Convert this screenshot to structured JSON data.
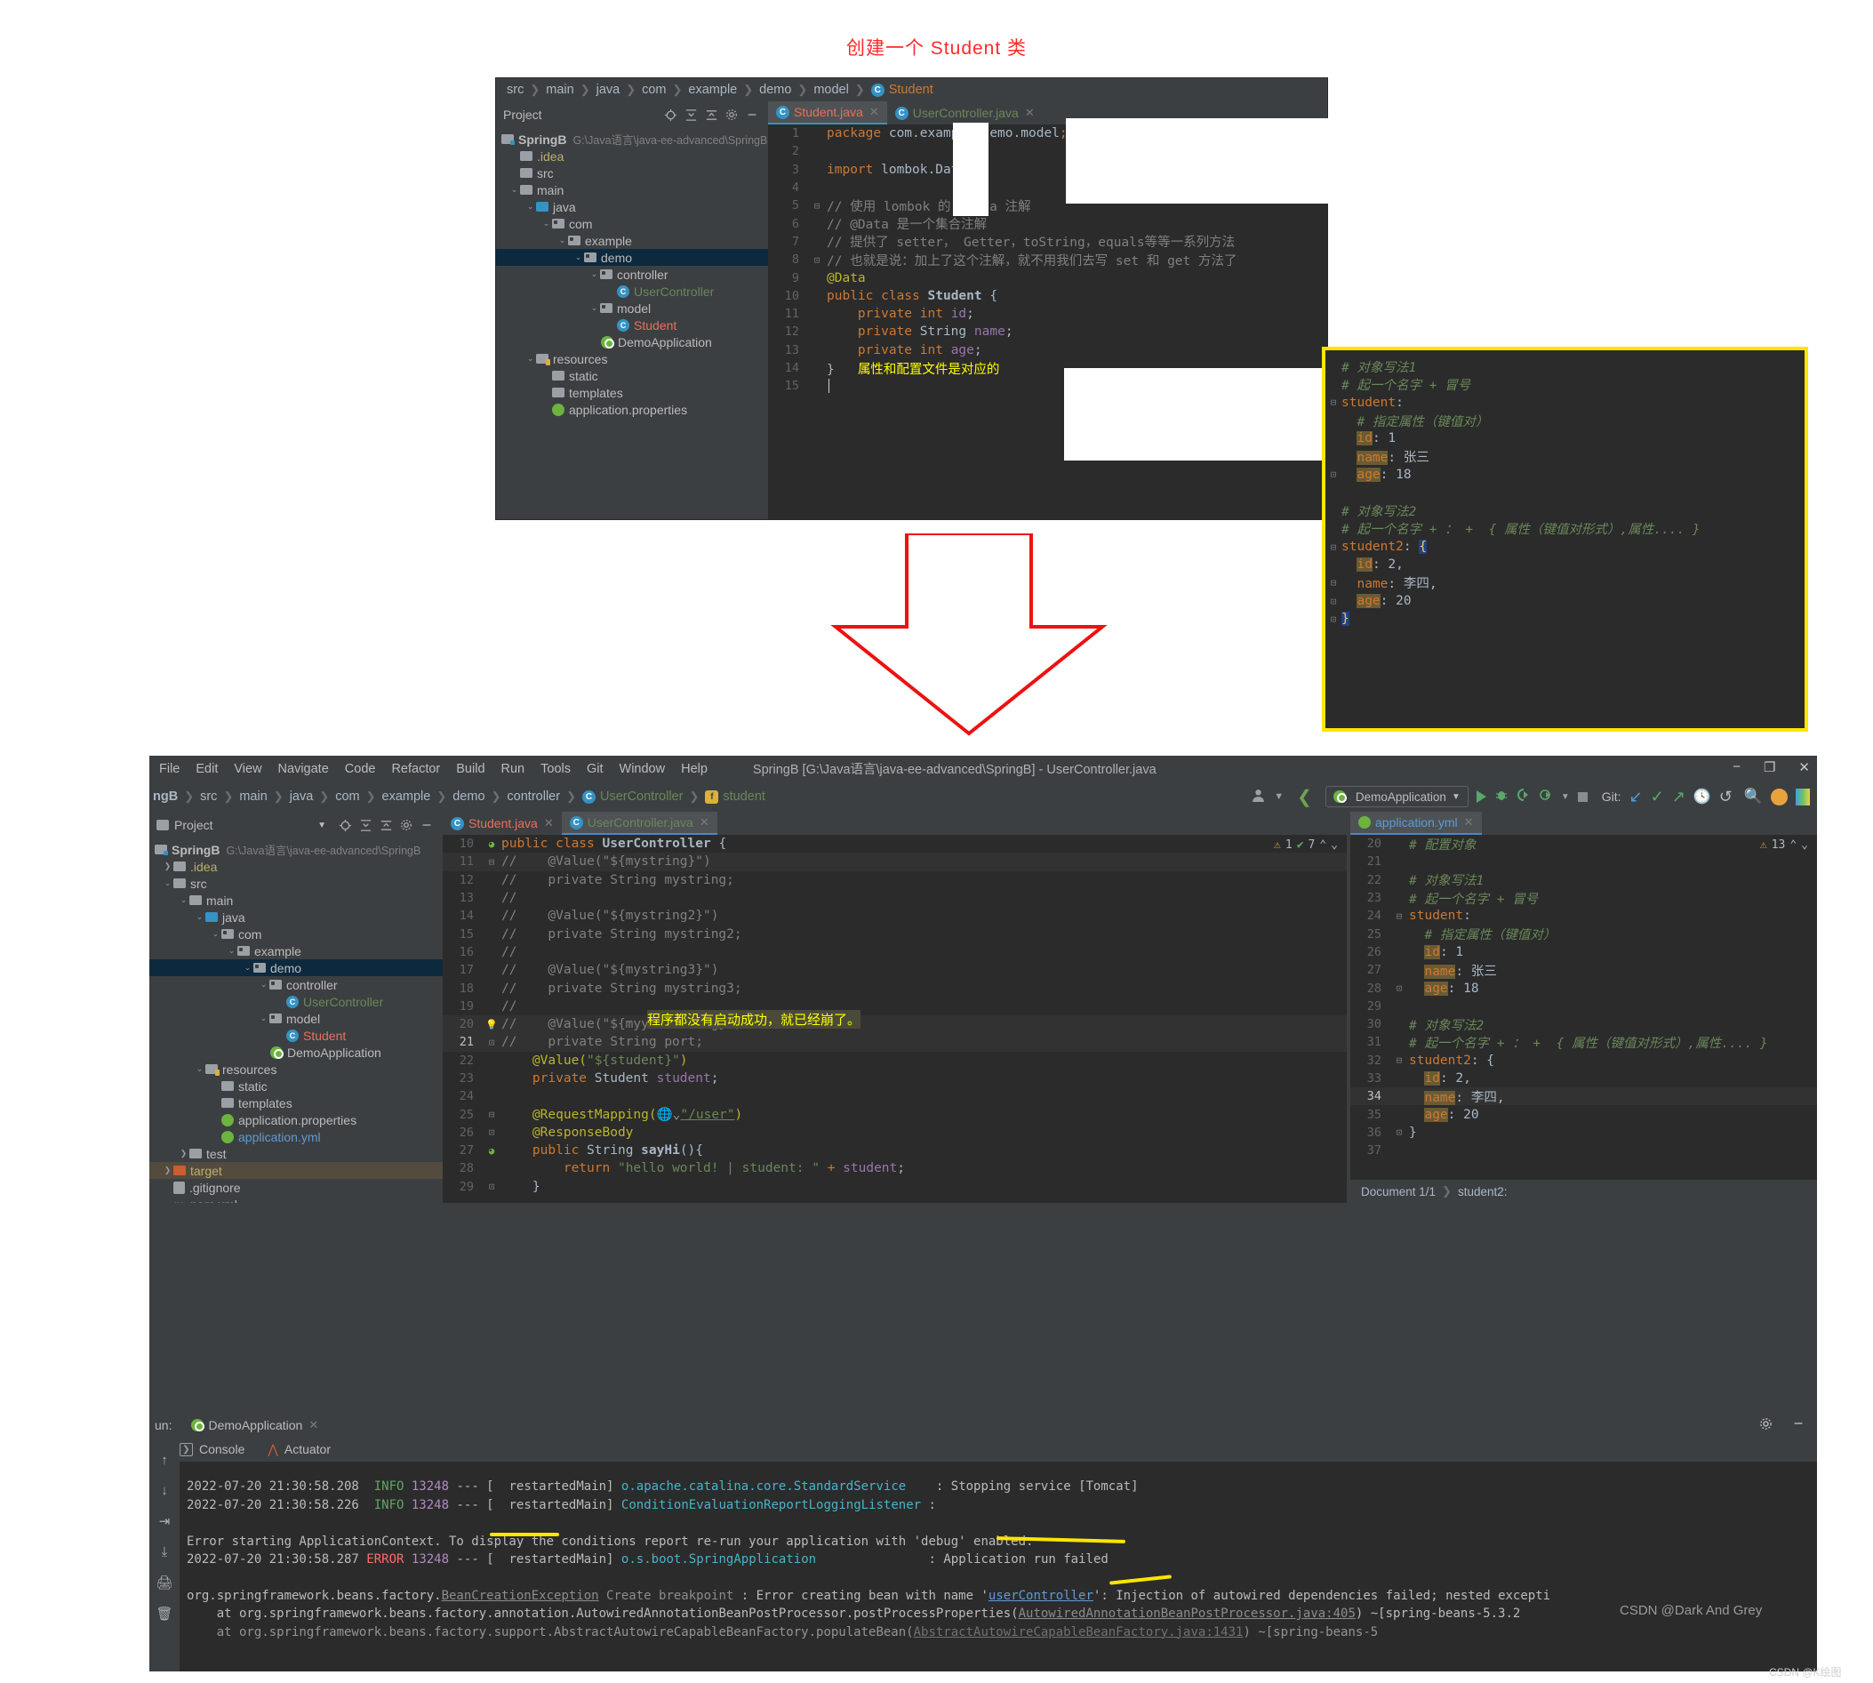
{
  "title": "创建一个 Student 类",
  "top_window": {
    "breadcrumb": [
      "src",
      "main",
      "java",
      "com",
      "example",
      "demo",
      "model"
    ],
    "breadcrumb_current": "Student",
    "project_panel": {
      "label": "Project",
      "root_name": "SpringB",
      "root_path": "G:\\Java语言\\java-ee-advanced\\SpringB",
      "items": [
        {
          "label": ".idea",
          "indent": 1
        },
        {
          "label": "src",
          "indent": 1
        },
        {
          "label": "main",
          "indent": 2
        },
        {
          "label": "java",
          "indent": 3
        },
        {
          "label": "com",
          "indent": 4
        },
        {
          "label": "example",
          "indent": 5
        },
        {
          "label": "demo",
          "indent": 6
        },
        {
          "label": "controller",
          "indent": 7
        },
        {
          "label": "UserController",
          "indent": 8
        },
        {
          "label": "model",
          "indent": 7
        },
        {
          "label": "Student",
          "indent": 8
        },
        {
          "label": "DemoApplication",
          "indent": 7
        },
        {
          "label": "resources",
          "indent": 3
        },
        {
          "label": "static",
          "indent": 4
        },
        {
          "label": "templates",
          "indent": 4
        },
        {
          "label": "application.properties",
          "indent": 4
        }
      ]
    },
    "tabs": [
      {
        "label": "Student.java",
        "active": true
      },
      {
        "label": "UserController.java",
        "active": false
      }
    ],
    "code_lines": [
      {
        "n": "1",
        "text": "package com.example.demo.model;"
      },
      {
        "n": "2",
        "text": ""
      },
      {
        "n": "3",
        "text": "import lombok.Data;"
      },
      {
        "n": "4",
        "text": ""
      },
      {
        "n": "5",
        "text": "// 使用 lombok 的 @Data 注解"
      },
      {
        "n": "6",
        "text": "// @Data 是一个集合注解"
      },
      {
        "n": "7",
        "text": "// 提供了 setter， Getter，toString，equals等等一系列方法"
      },
      {
        "n": "8",
        "text": "// 也就是说：加上了这个注解，就不用我们去写 set 和 get 方法了"
      },
      {
        "n": "9",
        "text": "@Data"
      },
      {
        "n": "10",
        "text": "public class Student {"
      },
      {
        "n": "11",
        "text": "    private int id;"
      },
      {
        "n": "12",
        "text": "    private String name;"
      },
      {
        "n": "13",
        "text": "    private int age;"
      },
      {
        "n": "14",
        "text": "}"
      },
      {
        "n": "15",
        "text": ""
      }
    ],
    "inline_note": "属性和配置文件是对应的"
  },
  "yml_card": {
    "lines": [
      "# 对象写法1",
      "# 起一个名字 + 冒号",
      "student:",
      "  # 指定属性（键值对）",
      "  id: 1",
      "  name: 张三",
      "  age: 18",
      "",
      "# 对象写法2",
      "# 起一个名字 + ： +  { 属性（键值对形式）,属性.... }",
      "student2: {",
      "  id: 2,",
      "  name: 李四,",
      "  age: 20",
      "}"
    ]
  },
  "bottom_window": {
    "menu": [
      "File",
      "Edit",
      "View",
      "Navigate",
      "Code",
      "Refactor",
      "Build",
      "Run",
      "Tools",
      "Git",
      "Window",
      "Help"
    ],
    "window_title": "SpringB [G:\\Java语言\\java-ee-advanced\\SpringB] - UserController.java",
    "window_buttons": [
      "−",
      "❐",
      "✕"
    ],
    "breadcrumb": [
      "ngB",
      "src",
      "main",
      "java",
      "com",
      "example",
      "demo",
      "controller"
    ],
    "breadcrumb_class": "UserController",
    "breadcrumb_field": "student",
    "toolbar": {
      "run_config": "DemoApplication",
      "git_label": "Git:"
    },
    "project_panel": {
      "label": "Project",
      "root_name": "SpringB",
      "root_path": "G:\\Java语言\\java-ee-advanced\\SpringB",
      "items": [
        {
          "label": ".idea",
          "indent": 1
        },
        {
          "label": "src",
          "indent": 1
        },
        {
          "label": "main",
          "indent": 2
        },
        {
          "label": "java",
          "indent": 3
        },
        {
          "label": "com",
          "indent": 4
        },
        {
          "label": "example",
          "indent": 5
        },
        {
          "label": "demo",
          "indent": 6
        },
        {
          "label": "controller",
          "indent": 7
        },
        {
          "label": "UserController",
          "indent": 8
        },
        {
          "label": "model",
          "indent": 7
        },
        {
          "label": "Student",
          "indent": 8
        },
        {
          "label": "DemoApplication",
          "indent": 7
        },
        {
          "label": "resources",
          "indent": 3
        },
        {
          "label": "static",
          "indent": 4
        },
        {
          "label": "templates",
          "indent": 4
        },
        {
          "label": "application.properties",
          "indent": 4
        },
        {
          "label": "application.yml",
          "indent": 4
        },
        {
          "label": "test",
          "indent": 2
        },
        {
          "label": "target",
          "indent": 1
        },
        {
          "label": ".gitignore",
          "indent": 1
        },
        {
          "label": "pom.xml",
          "indent": 1
        }
      ]
    },
    "tabs": [
      {
        "label": "Student.java",
        "active": false
      },
      {
        "label": "UserController.java",
        "active": true
      }
    ],
    "code_lines": [
      {
        "n": "10",
        "text": "public class UserController {"
      },
      {
        "n": "11",
        "text": "//    @Value(\"${mystring}\")"
      },
      {
        "n": "12",
        "text": "//    private String mystring;"
      },
      {
        "n": "13",
        "text": "//"
      },
      {
        "n": "14",
        "text": "//    @Value(\"${mystring2}\")"
      },
      {
        "n": "15",
        "text": "//    private String mystring2;"
      },
      {
        "n": "16",
        "text": "//"
      },
      {
        "n": "17",
        "text": "//    @Value(\"${mystring3}\")"
      },
      {
        "n": "18",
        "text": "//    private String mystring3;"
      },
      {
        "n": "19",
        "text": "//"
      },
      {
        "n": "20",
        "text": "//    @Value(\"${myyml.string}\")"
      },
      {
        "n": "21",
        "text": "//    private String port;"
      },
      {
        "n": "22",
        "text": "    @Value(\"${student}\")"
      },
      {
        "n": "23",
        "text": "    private Student student;"
      },
      {
        "n": "24",
        "text": ""
      },
      {
        "n": "25",
        "text": "    @RequestMapping(\"/user\")"
      },
      {
        "n": "26",
        "text": "    @ResponseBody"
      },
      {
        "n": "27",
        "text": "    public String sayHi(){"
      },
      {
        "n": "28",
        "text": "        return \"hello world! | student: \" + student;"
      },
      {
        "n": "29",
        "text": "    }"
      }
    ],
    "inspection": {
      "warnings": "1",
      "checks": "7"
    },
    "yml_tab": {
      "label": "application.yml",
      "warnings": "13"
    },
    "yml_lines": [
      {
        "n": "20",
        "text": "# 配置对象"
      },
      {
        "n": "21",
        "text": ""
      },
      {
        "n": "22",
        "text": "# 对象写法1"
      },
      {
        "n": "23",
        "text": "# 起一个名字 + 冒号"
      },
      {
        "n": "24",
        "text": "student:"
      },
      {
        "n": "25",
        "text": "  # 指定属性（键值对）"
      },
      {
        "n": "26",
        "text": "  id: 1"
      },
      {
        "n": "27",
        "text": "  name: 张三"
      },
      {
        "n": "28",
        "text": "  age: 18"
      },
      {
        "n": "29",
        "text": ""
      },
      {
        "n": "30",
        "text": "# 对象写法2"
      },
      {
        "n": "31",
        "text": "# 起一个名字 + ： +  { 属性（键值对形式）,属性.... }"
      },
      {
        "n": "32",
        "text": "student2: {"
      },
      {
        "n": "33",
        "text": "  id: 2,"
      },
      {
        "n": "34",
        "text": "  name: 李四,"
      },
      {
        "n": "35",
        "text": "  age: 20"
      },
      {
        "n": "36",
        "text": "}"
      },
      {
        "n": "37",
        "text": ""
      }
    ],
    "yml_status": {
      "document": "Document 1/1",
      "path": "student2:"
    },
    "run_panel": {
      "run_label": "un:",
      "config_tab": "DemoApplication",
      "tabs": [
        "Console",
        "Actuator"
      ],
      "annotation": "程序都没有启动成功，就已经崩了。",
      "console_lines": [
        "2022-07-20 21:30:58.208  INFO 13248 --- [  restartedMain] o.apache.catalina.core.StandardService    : Stopping service [Tomcat]",
        "2022-07-20 21:30:58.226  INFO 13248 --- [  restartedMain] ConditionEvaluationReportLoggingListener :",
        "",
        "Error starting ApplicationContext. To display the conditions report re-run your application with 'debug' enabled.",
        "2022-07-20 21:30:58.287 ERROR 13248 --- [  restartedMain] o.s.boot.SpringApplication               : Application run failed",
        "",
        "org.springframework.beans.factory.BeanCreationException Create breakpoint : Error creating bean with name 'userController': Injection of autowired dependencies failed; nested excepti",
        "    at org.springframework.beans.factory.annotation.AutowiredAnnotationBeanPostProcessor.postProcessProperties(AutowiredAnnotationBeanPostProcessor.java:405) ~[spring-beans-5.3.2",
        "    at org.springframework.beans.factory.support.AbstractAutowireCapableBeanFactory.populateBean(AbstractAutowireCapableBeanFactory.java:1431) ~[spring-beans-5"
      ]
    }
  },
  "watermarks": {
    "main": "CSDN @Dark And Grey",
    "corner": "CSDN @K绘图"
  }
}
